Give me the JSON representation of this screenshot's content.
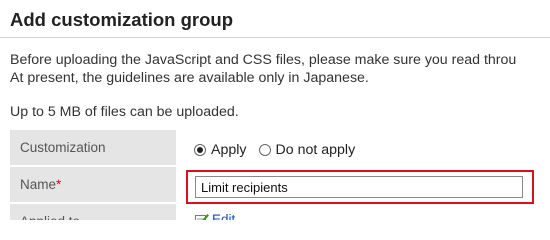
{
  "page": {
    "title": "Add customization group",
    "intro_line_1": "Before uploading the JavaScript and CSS files, please make sure you read throu",
    "intro_line_2": "At present, the guidelines are available only in Japanese.",
    "upload_limit": "Up to 5 MB of files can be uploaded."
  },
  "form": {
    "customization": {
      "label": "Customization",
      "options": [
        "Apply",
        "Do not apply"
      ],
      "selected": "Apply"
    },
    "name": {
      "label": "Name",
      "required_mark": "*",
      "value": "Limit recipients"
    },
    "applied_to": {
      "label": "Applied to",
      "edit_label": "Edit"
    }
  },
  "colors": {
    "highlight": "#d3121f",
    "label_bg": "#e5e5e5",
    "required": "#e0001b",
    "link": "#1a4fa8"
  }
}
